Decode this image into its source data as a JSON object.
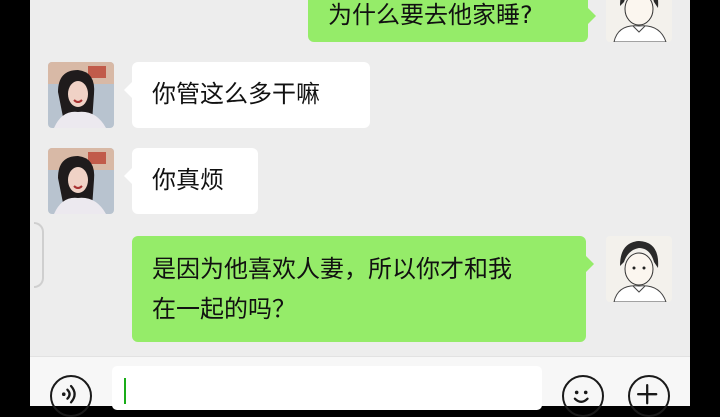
{
  "chat": {
    "messages": [
      {
        "side": "right",
        "sender": "me",
        "text": "为什么要去他家睡?"
      },
      {
        "side": "left",
        "sender": "contact",
        "text": "你管这么多干嘛"
      },
      {
        "side": "left",
        "sender": "contact",
        "text": "你真烦"
      },
      {
        "side": "right",
        "sender": "me",
        "text_line1": "是因为他喜欢人妻，所以你才和我",
        "text_line2": "在一起的吗？"
      }
    ]
  },
  "input_bar": {
    "value": "",
    "icons": [
      "voice-icon",
      "emoji-icon",
      "plus-icon"
    ]
  },
  "colors": {
    "background": "#ededed",
    "my_bubble": "#95ec69",
    "their_bubble": "#ffffff"
  }
}
